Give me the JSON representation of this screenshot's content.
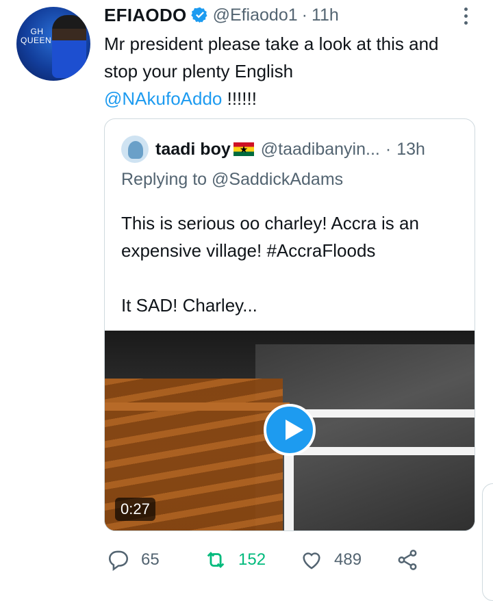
{
  "tweet": {
    "author_name": "EFIAODO",
    "author_handle": "@Efiaodo1",
    "separator": "·",
    "time": "11h",
    "text_main": "Mr president please take a look at this and stop your plenty English",
    "text_mention": "@NAkufoAddo",
    "text_suffix": " !!!!!!",
    "avatar_text": "GH QUEENS"
  },
  "quoted": {
    "author_name": "taadi boy",
    "author_handle": "@taadibanyin...",
    "separator": "·",
    "time": "13h",
    "replying_to": "Replying to @SaddickAdams",
    "text_line1": "This is serious oo charley! Accra is an expensive village! #AccraFloods",
    "text_line2": "It SAD! Charley...",
    "video_duration": "0:27"
  },
  "actions": {
    "replies": "65",
    "retweets": "152",
    "likes": "489"
  },
  "colors": {
    "accent": "#1d9bf0",
    "retweet": "#00ba7c",
    "secondary_text": "#536471"
  },
  "icons": [
    "verified-badge-icon",
    "more-options-icon",
    "reply-icon",
    "retweet-icon",
    "like-icon",
    "share-icon",
    "play-icon",
    "ghana-flag-icon"
  ]
}
